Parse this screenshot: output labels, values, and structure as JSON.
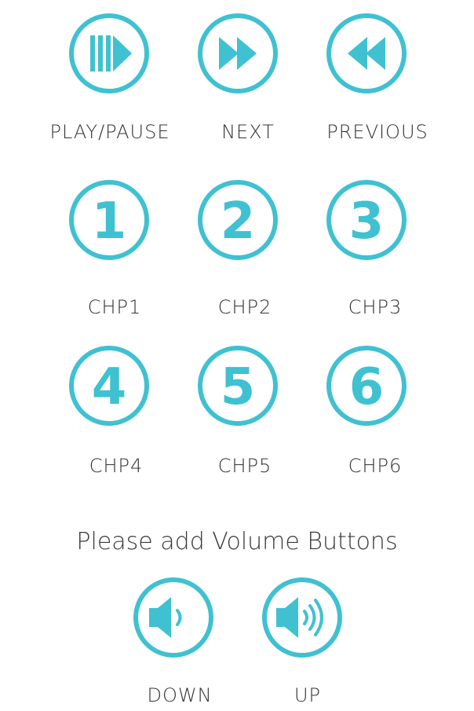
{
  "colors": {
    "accent": "#3fc1d1",
    "text": "#333333"
  },
  "controls": {
    "play_pause": {
      "label": "PLAY/PAUSE",
      "icon": "play-pause-icon"
    },
    "next": {
      "label": "NEXT",
      "icon": "fast-forward-icon"
    },
    "previous": {
      "label": "PREVIOUS",
      "icon": "rewind-icon"
    }
  },
  "chapters": [
    {
      "number": "1",
      "label": "CHP1"
    },
    {
      "number": "2",
      "label": "CHP2"
    },
    {
      "number": "3",
      "label": "CHP3"
    },
    {
      "number": "4",
      "label": "CHP4"
    },
    {
      "number": "5",
      "label": "CHP5"
    },
    {
      "number": "6",
      "label": "CHP6"
    }
  ],
  "volume_note": "Please add Volume Buttons",
  "volume": {
    "down": {
      "label": "DOWN",
      "icon": "volume-down-icon"
    },
    "up": {
      "label": "UP",
      "icon": "volume-up-icon"
    }
  }
}
